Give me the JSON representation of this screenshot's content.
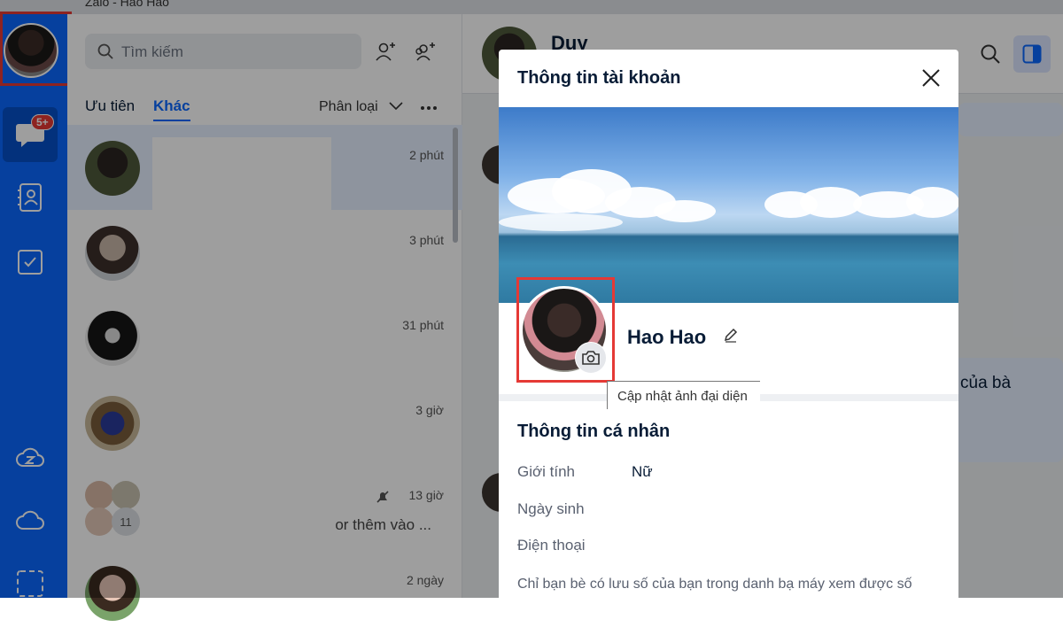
{
  "window": {
    "title": "Zalo - Hao Hao"
  },
  "nav": {
    "badge": "5+"
  },
  "list": {
    "search_placeholder": "Tìm kiếm",
    "tabs": [
      {
        "label": "Ưu tiên"
      },
      {
        "label": "Khác"
      }
    ],
    "filter_label": "Phân loại",
    "conversations": [
      {
        "time": "2 phút",
        "snippet": ""
      },
      {
        "time": "3 phút",
        "snippet": ""
      },
      {
        "time": "31 phút",
        "snippet": ""
      },
      {
        "time": "3 giờ",
        "snippet": ""
      },
      {
        "time": "13 giờ",
        "snippet": "or thêm vào ...",
        "member_count": "11"
      },
      {
        "time": "2 ngày",
        "snippet": ""
      }
    ]
  },
  "chat": {
    "contact_name": "Duy",
    "bubble_text": "của bà"
  },
  "modal": {
    "title": "Thông tin tài khoản",
    "profile_name": "Hao Hao",
    "tooltip": "Cập nhật ảnh đại diện",
    "section_title": "Thông tin cá nhân",
    "fields": [
      {
        "label": "Giới tính",
        "value": "Nữ"
      },
      {
        "label": "Ngày sinh",
        "value": ""
      },
      {
        "label": "Điện thoại",
        "value": ""
      }
    ],
    "privacy_note": "Chỉ bạn bè có lưu số của bạn trong danh bạ máy xem được số"
  },
  "colors": {
    "accent": "#0a68ff",
    "highlight_border": "#e53935",
    "badge": "#e53935"
  }
}
